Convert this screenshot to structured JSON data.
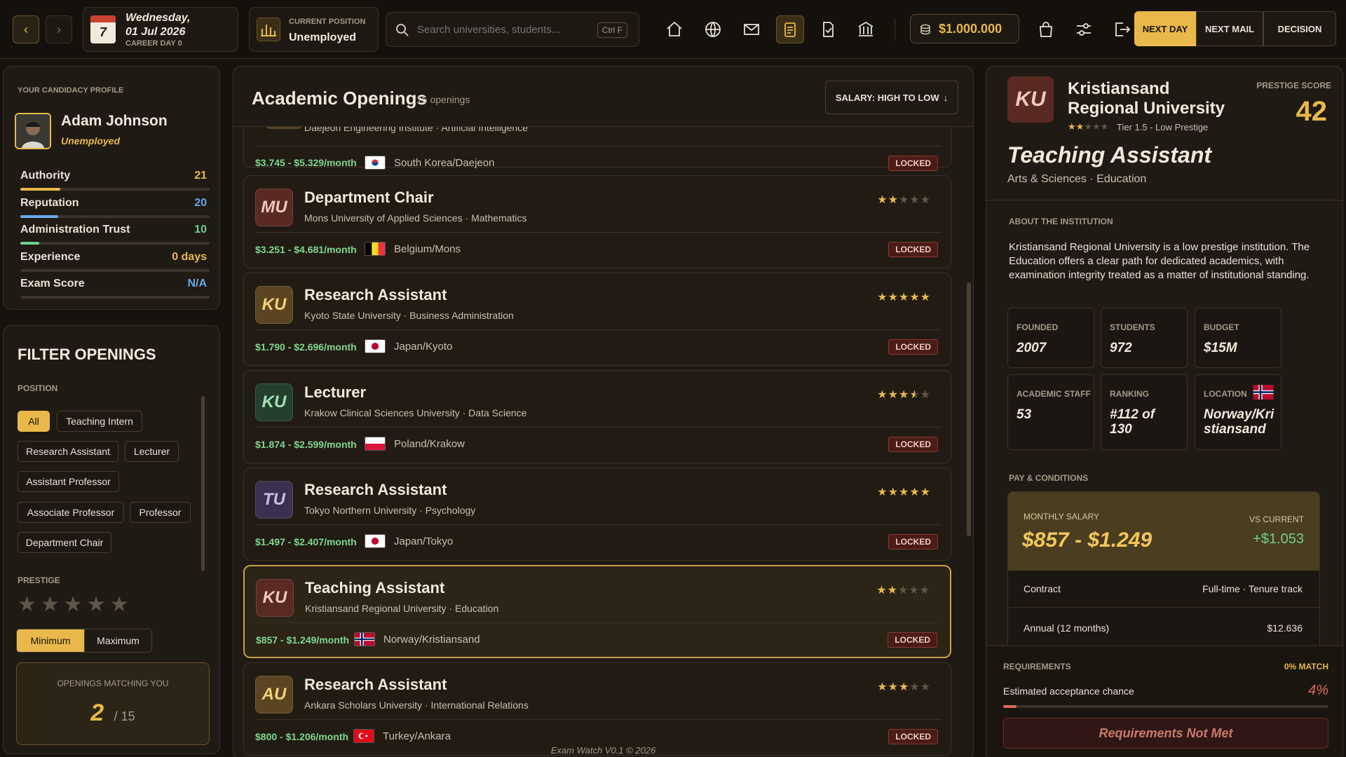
{
  "topbar": {
    "date": {
      "weekday": "Wednesday,",
      "date": "01 Jul 2026",
      "career_day": "CAREER DAY 0",
      "calendar_day": "7"
    },
    "position": {
      "label": "CURRENT POSITION",
      "value": "Unemployed"
    },
    "search": {
      "placeholder": "Search universities, students...",
      "shortcut": "Ctrl F"
    },
    "money": "$1.000.000",
    "buttons": {
      "next_day": "NEXT DAY",
      "next_mail": "NEXT MAIL",
      "decision": "DECISION"
    },
    "colors": {
      "accent": "#e9b84a",
      "active_icon_bg": "#3a2f14"
    }
  },
  "profile": {
    "heading": "YOUR CANDIDACY PROFILE",
    "name": "Adam Johnson",
    "status": "Unemployed",
    "stats": [
      {
        "label": "Authority",
        "value": "21",
        "fill": 0.21,
        "color": "#e9b84a"
      },
      {
        "label": "Reputation",
        "value": "20",
        "fill": 0.2,
        "color": "#6aa8e8"
      },
      {
        "label": "Administration Trust",
        "value": "10",
        "fill": 0.1,
        "color": "#6fd08c"
      },
      {
        "label": "Experience",
        "value": "0 days",
        "fill": 0,
        "color": "#e9b84a"
      },
      {
        "label": "Exam Score",
        "value": "N/A",
        "fill": 0,
        "color": "#6aa8e8"
      }
    ]
  },
  "filters": {
    "title": "FILTER OPENINGS",
    "position_label": "POSITION",
    "chips": [
      "All",
      "Teaching Intern",
      "Research Assistant",
      "Lecturer",
      "Assistant Professor",
      "Associate Professor",
      "Professor",
      "Department Chair"
    ],
    "prestige_label": "PRESTIGE",
    "min_label": "Minimum",
    "max_label": "Maximum",
    "matching_label": "OPENINGS MATCHING YOU",
    "matching_count": "2",
    "matching_total": "/ 15"
  },
  "openings": {
    "title": "Academic Openings",
    "count": "15 openings",
    "sort": "SALARY: HIGH TO LOW",
    "sort_arrow": "↓",
    "partial": {
      "subtitle": "Daejeon Engineering Institute · Artificial Intelligence",
      "salary": "$3.745 - $5.329/month",
      "location": "South Korea/Daejeon",
      "flag": "kr",
      "status": "LOCKED"
    },
    "items": [
      {
        "logo": "MU",
        "logo_bg": "#5a2a22",
        "logo_color": "#f0c9b8",
        "title": "Department Chair",
        "subtitle": "Mons University of Applied Sciences · Mathematics",
        "stars": 2,
        "salary": "$3.251 - $4.681/month",
        "location": "Belgium/Mons",
        "flag": "be",
        "status": "LOCKED"
      },
      {
        "logo": "KU",
        "logo_bg": "#5a4520",
        "logo_color": "#f3d27a",
        "title": "Research Assistant",
        "subtitle": "Kyoto State University · Business Administration",
        "stars": 5,
        "salary": "$1.790 - $2.696/month",
        "location": "Japan/Kyoto",
        "flag": "jp",
        "status": "LOCKED"
      },
      {
        "logo": "KU",
        "logo_bg": "#23402e",
        "logo_color": "#a8e0b8",
        "title": "Lecturer",
        "subtitle": "Krakow Clinical Sciences University · Data Science",
        "stars": 3.5,
        "salary": "$1.874 - $2.599/month",
        "location": "Poland/Krakow",
        "flag": "pl",
        "status": "LOCKED"
      },
      {
        "logo": "TU",
        "logo_bg": "#3a3050",
        "logo_color": "#cbbfe8",
        "title": "Research Assistant",
        "subtitle": "Tokyo Northern University · Psychology",
        "stars": 5,
        "salary": "$1.497 - $2.407/month",
        "location": "Japan/Tokyo",
        "flag": "jp",
        "status": "LOCKED"
      },
      {
        "logo": "KU",
        "logo_bg": "#5a2a22",
        "logo_color": "#f0c9b8",
        "title": "Teaching Assistant",
        "subtitle": "Kristiansand Regional University · Education",
        "stars": 2,
        "salary": "$857 - $1.249/month",
        "location": "Norway/Kristiansand",
        "flag": "no",
        "status": "LOCKED",
        "selected": true
      },
      {
        "logo": "AU",
        "logo_bg": "#5a4520",
        "logo_color": "#f3d27a",
        "title": "Research Assistant",
        "subtitle": "Ankara Scholars University · International Relations",
        "stars": 3,
        "salary": "$800 - $1.206/month",
        "location": "Turkey/Ankara",
        "flag": "tr",
        "status": "LOCKED"
      }
    ],
    "footer": "Exam Watch V0.1 © 2026"
  },
  "detail": {
    "logo": "KU",
    "university": "Kristiansand Regional University",
    "tier": "Tier 1.5 - Low Prestige",
    "stars": 2,
    "prestige_label": "PRESTIGE SCORE",
    "prestige": "42",
    "position": "Teaching Assistant",
    "field": "Arts & Sciences · Education",
    "about_label": "ABOUT THE INSTITUTION",
    "about": "Kristiansand Regional University is a low prestige institution. The Education offers a clear path for dedicated academics, with examination integrity treated as a matter of institutional standing.",
    "info": {
      "founded_label": "FOUNDED",
      "founded": "2007",
      "students_label": "STUDENTS",
      "students": "972",
      "budget_label": "BUDGET",
      "budget": "$15M",
      "staff_label": "ACADEMIC STAFF",
      "staff": "53",
      "ranking_label": "RANKING",
      "ranking": "#112 of 130",
      "location_label": "LOCATION",
      "location": "Norway/Kristiansand"
    },
    "pay_label": "PAY & CONDITIONS",
    "monthly_label": "MONTHLY SALARY",
    "monthly": "$857 - $1.249",
    "vs_label": "VS CURRENT",
    "vs": "+$1.053",
    "contract_label": "Contract",
    "contract": "Full-time · Tenure track",
    "annual_label": "Annual (12 months)",
    "annual": "$12.636",
    "req_label": "REQUIREMENTS",
    "match": "0% MATCH",
    "chance_label": "Estimated acceptance chance",
    "chance": "4%",
    "chance_fill": 0.04,
    "req_button": "Requirements Not Met"
  }
}
